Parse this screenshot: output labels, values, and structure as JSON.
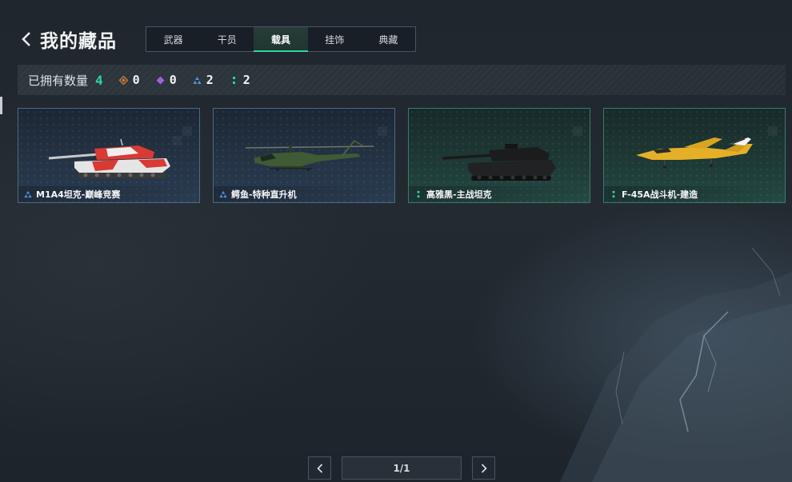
{
  "header": {
    "title": "我的藏品",
    "back_icon": "chevron-left-icon"
  },
  "tabs": [
    {
      "label": "武器",
      "active": false
    },
    {
      "label": "干员",
      "active": false
    },
    {
      "label": "载具",
      "active": true
    },
    {
      "label": "挂饰",
      "active": false
    },
    {
      "label": "典藏",
      "active": false
    }
  ],
  "owned": {
    "label": "已拥有数量",
    "total": "4",
    "rarities": [
      {
        "icon": "orange-diamond-icon",
        "color": "#c8783a",
        "count": "0"
      },
      {
        "icon": "purple-diamond-icon",
        "color": "#9b63e0",
        "count": "0"
      },
      {
        "icon": "blue-triangle-icon",
        "color": "#4f93d6",
        "count": "2"
      },
      {
        "icon": "green-dots-icon",
        "color": "#2fd59a",
        "count": "2"
      }
    ]
  },
  "items": [
    {
      "name": "M1A4坦克-巅峰竞赛",
      "rarity": "blue",
      "icon": "blue-triangle-icon",
      "art": "tank-icon"
    },
    {
      "name": "鳄鱼-特种直升机",
      "rarity": "blue",
      "icon": "blue-triangle-icon",
      "art": "helicopter-icon"
    },
    {
      "name": "高雅黑-主战坦克",
      "rarity": "green",
      "icon": "green-dots-icon",
      "art": "tank-icon"
    },
    {
      "name": "F-45A战斗机-建造",
      "rarity": "green",
      "icon": "green-dots-icon",
      "art": "jet-icon"
    }
  ],
  "pagination": {
    "text": "1/1",
    "prev_icon": "chevron-left-icon",
    "next_icon": "chevron-right-icon"
  },
  "colors": {
    "accent_green": "#2fd59a",
    "rarity_blue": "#4f93d6",
    "rarity_green": "#2fd59a"
  }
}
